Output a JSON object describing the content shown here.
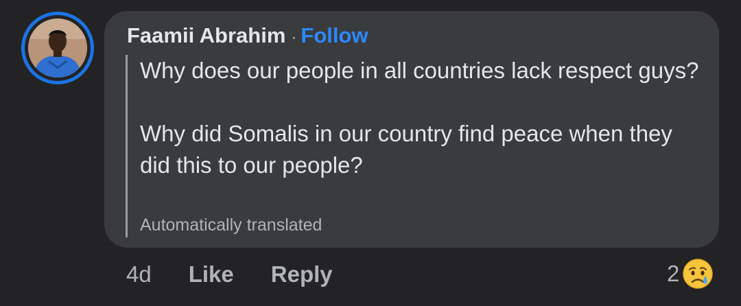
{
  "comment": {
    "author_name": "Faamii Abrahim",
    "separator": "·",
    "follow_label": "Follow",
    "body_paragraph_1": "Why does our people in all countries lack respect guys?",
    "body_paragraph_2": "Why did Somalis in our country find peace when they did this to our people?",
    "translation_note": "Automatically translated"
  },
  "actions": {
    "time": "4d",
    "like_label": "Like",
    "reply_label": "Reply"
  },
  "reactions": {
    "count": "2",
    "icon": "sad-face-with-tear-icon"
  },
  "colors": {
    "background": "#232325",
    "bubble": "#3a3b3d",
    "accent": "#1b74e4",
    "follow": "#2d88ff",
    "text_primary": "#e4e6eb",
    "text_secondary": "#b0b3b8"
  }
}
